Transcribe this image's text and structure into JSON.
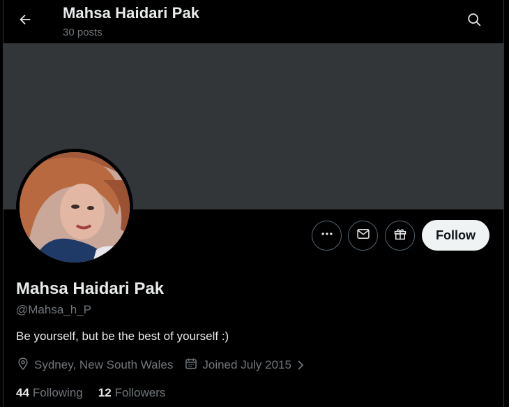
{
  "header": {
    "title": "Mahsa Haidari Pak",
    "posts": "30 posts"
  },
  "profile": {
    "name": "Mahsa Haidari Pak",
    "handle": "@Mahsa_h_P",
    "bio": "Be yourself, but be the best of yourself :)",
    "location": "Sydney, New South Wales",
    "joined": "Joined July 2015"
  },
  "actions": {
    "follow_label": "Follow"
  },
  "stats": {
    "following_count": "44",
    "following_label": "Following",
    "followers_count": "12",
    "followers_label": "Followers"
  },
  "colors": {
    "background": "#000000",
    "banner": "#333639",
    "primary_text": "#e7e9ea",
    "secondary_text": "#71767b",
    "button_border": "#536471",
    "follow_bg": "#eff3f4"
  },
  "icons": [
    "back-arrow-icon",
    "search-icon",
    "more-icon",
    "message-icon",
    "gift-icon",
    "location-icon",
    "calendar-icon",
    "chevron-right-icon"
  ]
}
